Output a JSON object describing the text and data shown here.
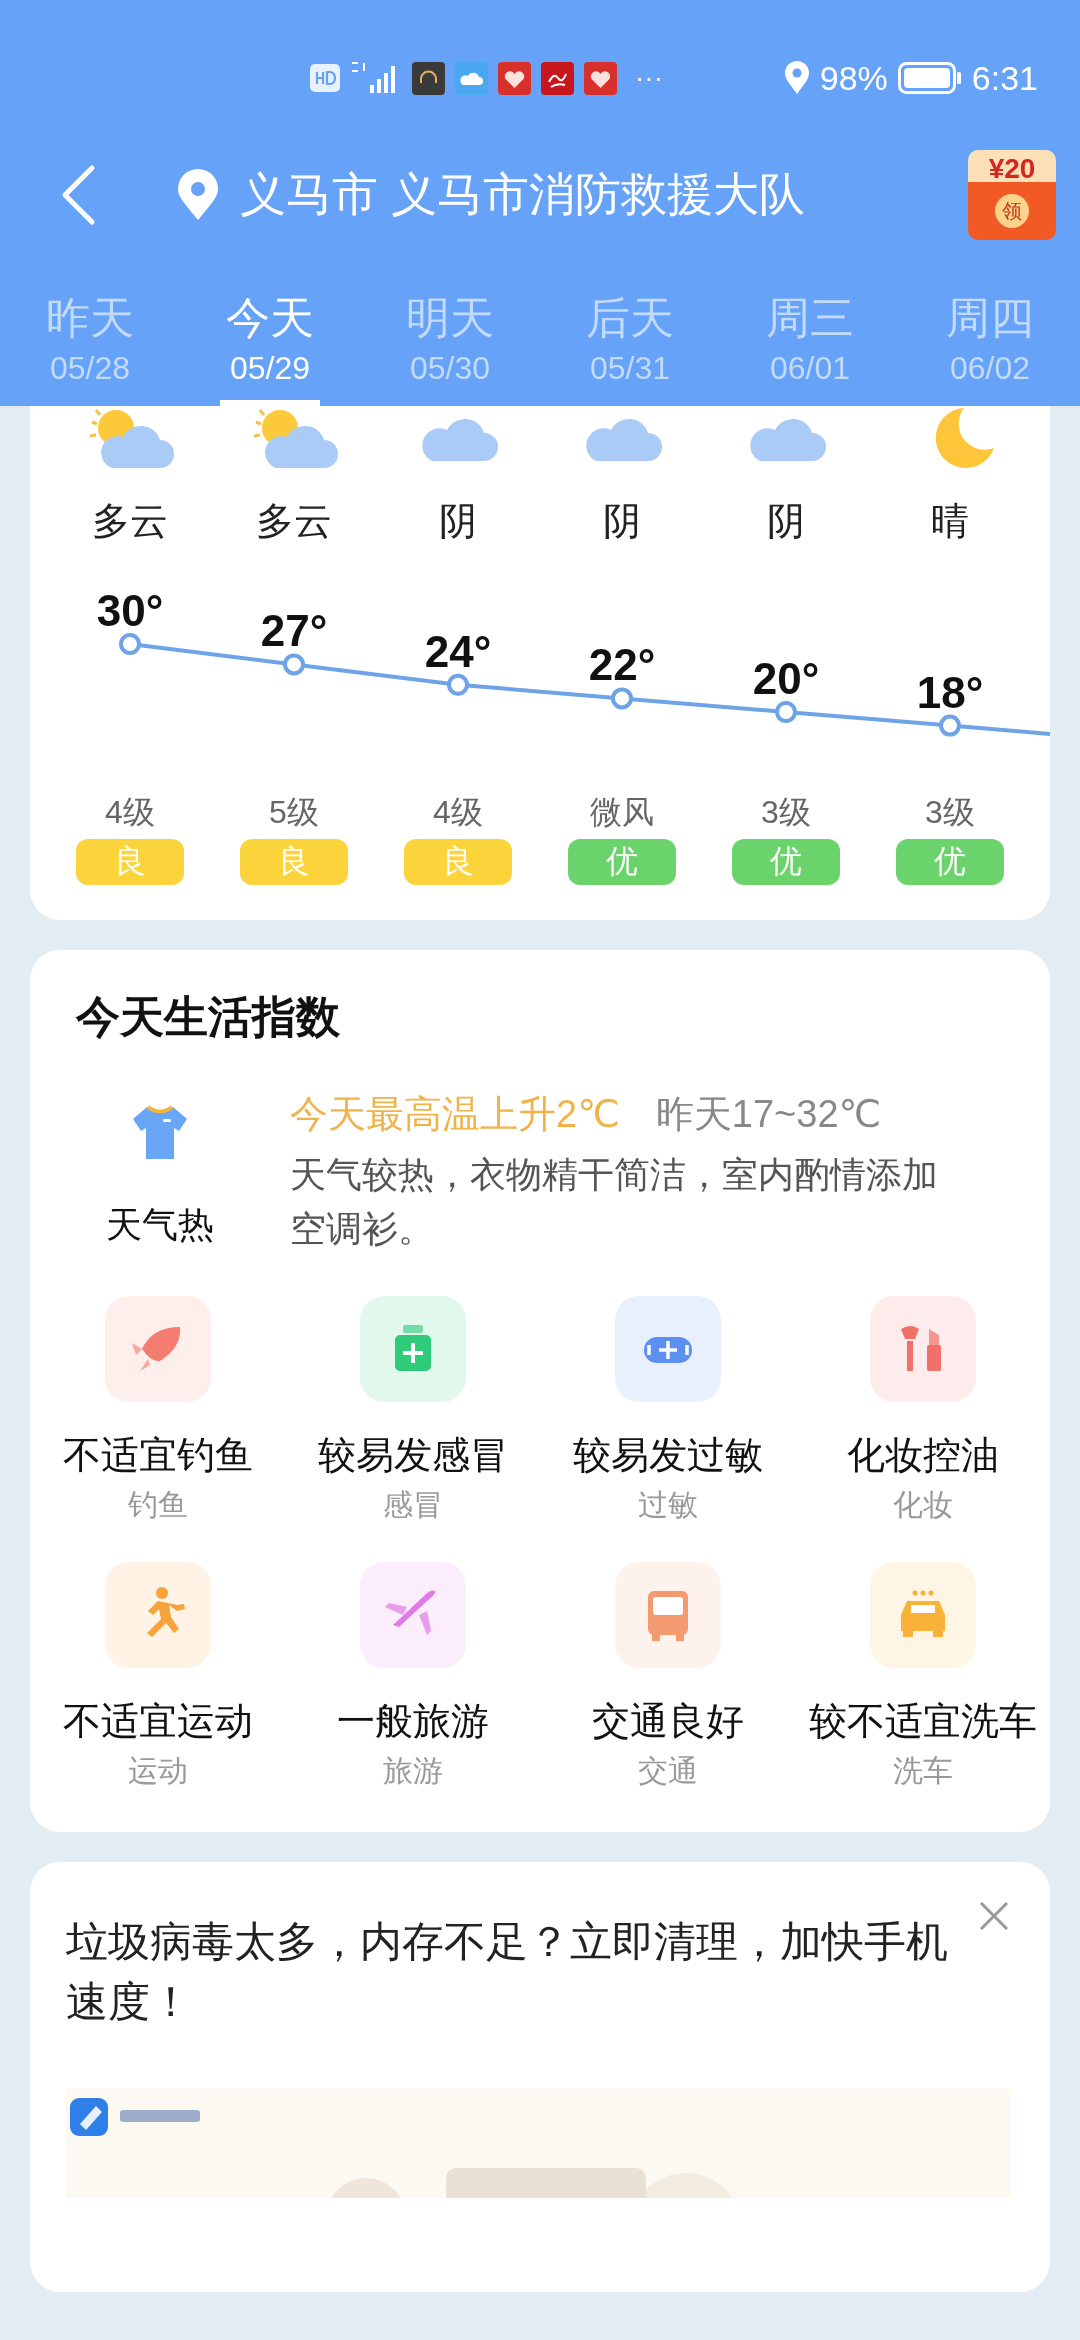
{
  "status_bar": {
    "more": "···",
    "battery_percent": "98%",
    "time": "6:31",
    "notification_apps": [
      {
        "kind": "headphones",
        "color": "#3a3a3a"
      },
      {
        "kind": "weather",
        "color": "#4aa8f0"
      },
      {
        "kind": "heart",
        "color": "#d9302c"
      },
      {
        "kind": "script",
        "color": "#c8161d"
      },
      {
        "kind": "heart",
        "color": "#d9302c"
      }
    ]
  },
  "header": {
    "title": "义马市 义马市消防救援大队",
    "coupon": {
      "amount": "¥20",
      "action": "领"
    }
  },
  "tabs": [
    {
      "label": "昨天",
      "date": "05/28",
      "selected": false
    },
    {
      "label": "今天",
      "date": "05/29",
      "selected": true
    },
    {
      "label": "明天",
      "date": "05/30",
      "selected": false
    },
    {
      "label": "后天",
      "date": "05/31",
      "selected": false
    },
    {
      "label": "周三",
      "date": "06/01",
      "selected": false
    },
    {
      "label": "周四",
      "date": "06/02",
      "selected": false
    }
  ],
  "forecast": {
    "days": [
      {
        "kind": "partly_cloudy",
        "condition": "多云",
        "temp": "30°",
        "wind": "4级",
        "aqi": {
          "label": "良",
          "color": "#fbd43b"
        }
      },
      {
        "kind": "partly_cloudy",
        "condition": "多云",
        "temp": "27°",
        "wind": "5级",
        "aqi": {
          "label": "良",
          "color": "#fbd43b"
        }
      },
      {
        "kind": "cloudy",
        "condition": "阴",
        "temp": "24°",
        "wind": "4级",
        "aqi": {
          "label": "良",
          "color": "#fbd43b"
        }
      },
      {
        "kind": "cloudy",
        "condition": "阴",
        "temp": "22°",
        "wind": "微风",
        "aqi": {
          "label": "优",
          "color": "#6bd36b"
        }
      },
      {
        "kind": "cloudy",
        "condition": "阴",
        "temp": "20°",
        "wind": "3级",
        "aqi": {
          "label": "优",
          "color": "#6bd36b"
        }
      },
      {
        "kind": "clear_night",
        "condition": "晴",
        "temp": "18°",
        "wind": "3级",
        "aqi": {
          "label": "优",
          "color": "#6bd36b"
        }
      }
    ]
  },
  "life_index": {
    "title": "今天生活指数",
    "clothing": {
      "label": "天气热",
      "headline": "今天最高温上升2℃",
      "compare": "昨天17~32℃",
      "advice": "天气较热，衣物精干简洁，室内酌情添加空调衫。"
    },
    "items": [
      {
        "kind": "fish",
        "title": "不适宜钓鱼",
        "category": "钓鱼",
        "color": "#f47c70"
      },
      {
        "kind": "medicine",
        "title": "较易发感冒",
        "category": "感冒",
        "color": "#2fcb7a"
      },
      {
        "kind": "mask",
        "title": "较易发过敏",
        "category": "过敏",
        "color": "#5b8ff0"
      },
      {
        "kind": "makeup",
        "title": "化妆控油",
        "category": "化妆",
        "color": "#f0706a"
      },
      {
        "kind": "run",
        "title": "不适宜运动",
        "category": "运动",
        "color": "#f8a23a"
      },
      {
        "kind": "plane",
        "title": "一般旅游",
        "category": "旅游",
        "color": "#e07ae6"
      },
      {
        "kind": "bus",
        "title": "交通良好",
        "category": "交通",
        "color": "#f49a70"
      },
      {
        "kind": "taxi",
        "title": "较不适宜洗车",
        "category": "洗车",
        "color": "#f8b23a"
      }
    ]
  },
  "ad": {
    "text": "垃圾病毒太多，内存不足？立即清理，加快手机速度！"
  }
}
